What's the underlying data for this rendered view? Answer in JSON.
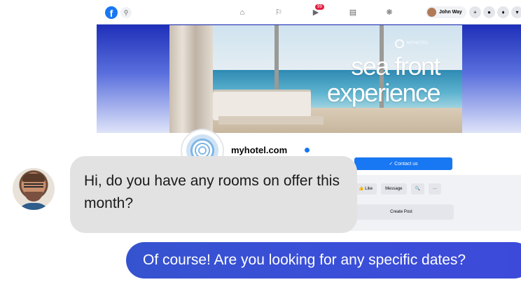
{
  "facebook": {
    "logo": "f",
    "top_nav": [
      "home-icon",
      "flag-icon",
      "video-icon",
      "marketplace-icon",
      "groups-icon"
    ],
    "notification_badge": "99",
    "user_name": "John Way",
    "page": {
      "cover_brand": "MYHOTEL",
      "cover_headline_line1": "sea front",
      "cover_headline_line2": "experience",
      "name": "myhotel.com",
      "contact_button": "✓ Contact us",
      "actions": [
        "👍 Like",
        "Message",
        "🔍",
        "···"
      ],
      "create_post": "Create Post"
    }
  },
  "chat": {
    "incoming": "Hi, do you have any rooms on offer this month?",
    "outgoing": "Of course! Are you looking for any specific dates?"
  },
  "colors": {
    "facebook_blue": "#1877f2",
    "bubble_in": "#e2e2e2",
    "bubble_out": "#3a4fd8"
  }
}
